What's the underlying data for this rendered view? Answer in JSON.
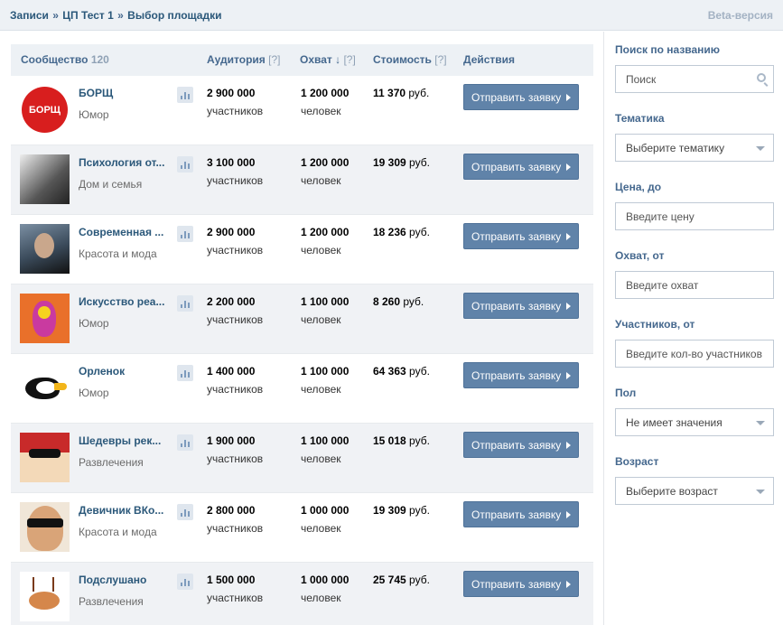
{
  "breadcrumb": {
    "items": [
      "Записи",
      "ЦП Тест 1",
      "Выбор площадки"
    ],
    "separator": "»"
  },
  "beta_label": "Beta-версия",
  "table": {
    "headers": {
      "community": "Сообщество",
      "community_count": "120",
      "audience": "Аудитория",
      "reach": "Охват ↓",
      "price": "Стоимость",
      "actions": "Действия",
      "hint": "[?]"
    },
    "rows": [
      {
        "name": "БОРЩ",
        "category": "Юмор",
        "audience": "2 900 000",
        "audience_unit": "участников",
        "reach": "1 200 000",
        "reach_unit": "человек",
        "price": "11 370",
        "currency": "руб.",
        "action": "Отправить заявку"
      },
      {
        "name": "Психология от...",
        "category": "Дом и семья",
        "audience": "3 100 000",
        "audience_unit": "участников",
        "reach": "1 200 000",
        "reach_unit": "человек",
        "price": "19 309",
        "currency": "руб.",
        "action": "Отправить заявку"
      },
      {
        "name": "Современная ...",
        "category": "Красота и мода",
        "audience": "2 900 000",
        "audience_unit": "участников",
        "reach": "1 200 000",
        "reach_unit": "человек",
        "price": "18 236",
        "currency": "руб.",
        "action": "Отправить заявку"
      },
      {
        "name": "Искусство реа...",
        "category": "Юмор",
        "audience": "2 200 000",
        "audience_unit": "участников",
        "reach": "1 100 000",
        "reach_unit": "человек",
        "price": "8 260",
        "currency": "руб.",
        "action": "Отправить заявку"
      },
      {
        "name": "Орленок",
        "category": "Юмор",
        "audience": "1 400 000",
        "audience_unit": "участников",
        "reach": "1 100 000",
        "reach_unit": "человек",
        "price": "64 363",
        "currency": "руб.",
        "action": "Отправить заявку"
      },
      {
        "name": "Шедевры рек...",
        "category": "Развлечения",
        "audience": "1 900 000",
        "audience_unit": "участников",
        "reach": "1 100 000",
        "reach_unit": "человек",
        "price": "15 018",
        "currency": "руб.",
        "action": "Отправить заявку"
      },
      {
        "name": "Девичник ВКо...",
        "category": "Красота и мода",
        "audience": "2 800 000",
        "audience_unit": "участников",
        "reach": "1 000 000",
        "reach_unit": "человек",
        "price": "19 309",
        "currency": "руб.",
        "action": "Отправить заявку"
      },
      {
        "name": "Подслушано",
        "category": "Развлечения",
        "audience": "1 500 000",
        "audience_unit": "участников",
        "reach": "1 000 000",
        "reach_unit": "человек",
        "price": "25 745",
        "currency": "руб.",
        "action": "Отправить заявку"
      }
    ],
    "avatar_logo_text": "БОРЩ"
  },
  "filters": {
    "search": {
      "label": "Поиск по названию",
      "placeholder": "Поиск"
    },
    "topic": {
      "label": "Тематика",
      "value": "Выберите тематику"
    },
    "price": {
      "label": "Цена, до",
      "placeholder": "Введите цену"
    },
    "reach": {
      "label": "Охват, от",
      "placeholder": "Введите охват"
    },
    "members": {
      "label": "Участников, от",
      "placeholder": "Введите кол-во участников"
    },
    "gender": {
      "label": "Пол",
      "value": "Не имеет значения"
    },
    "age": {
      "label": "Возраст",
      "value": "Выберите возраст"
    }
  },
  "colors": {
    "accent": "#45688e",
    "button": "#6083a9",
    "header_bg": "#edf1f5"
  }
}
